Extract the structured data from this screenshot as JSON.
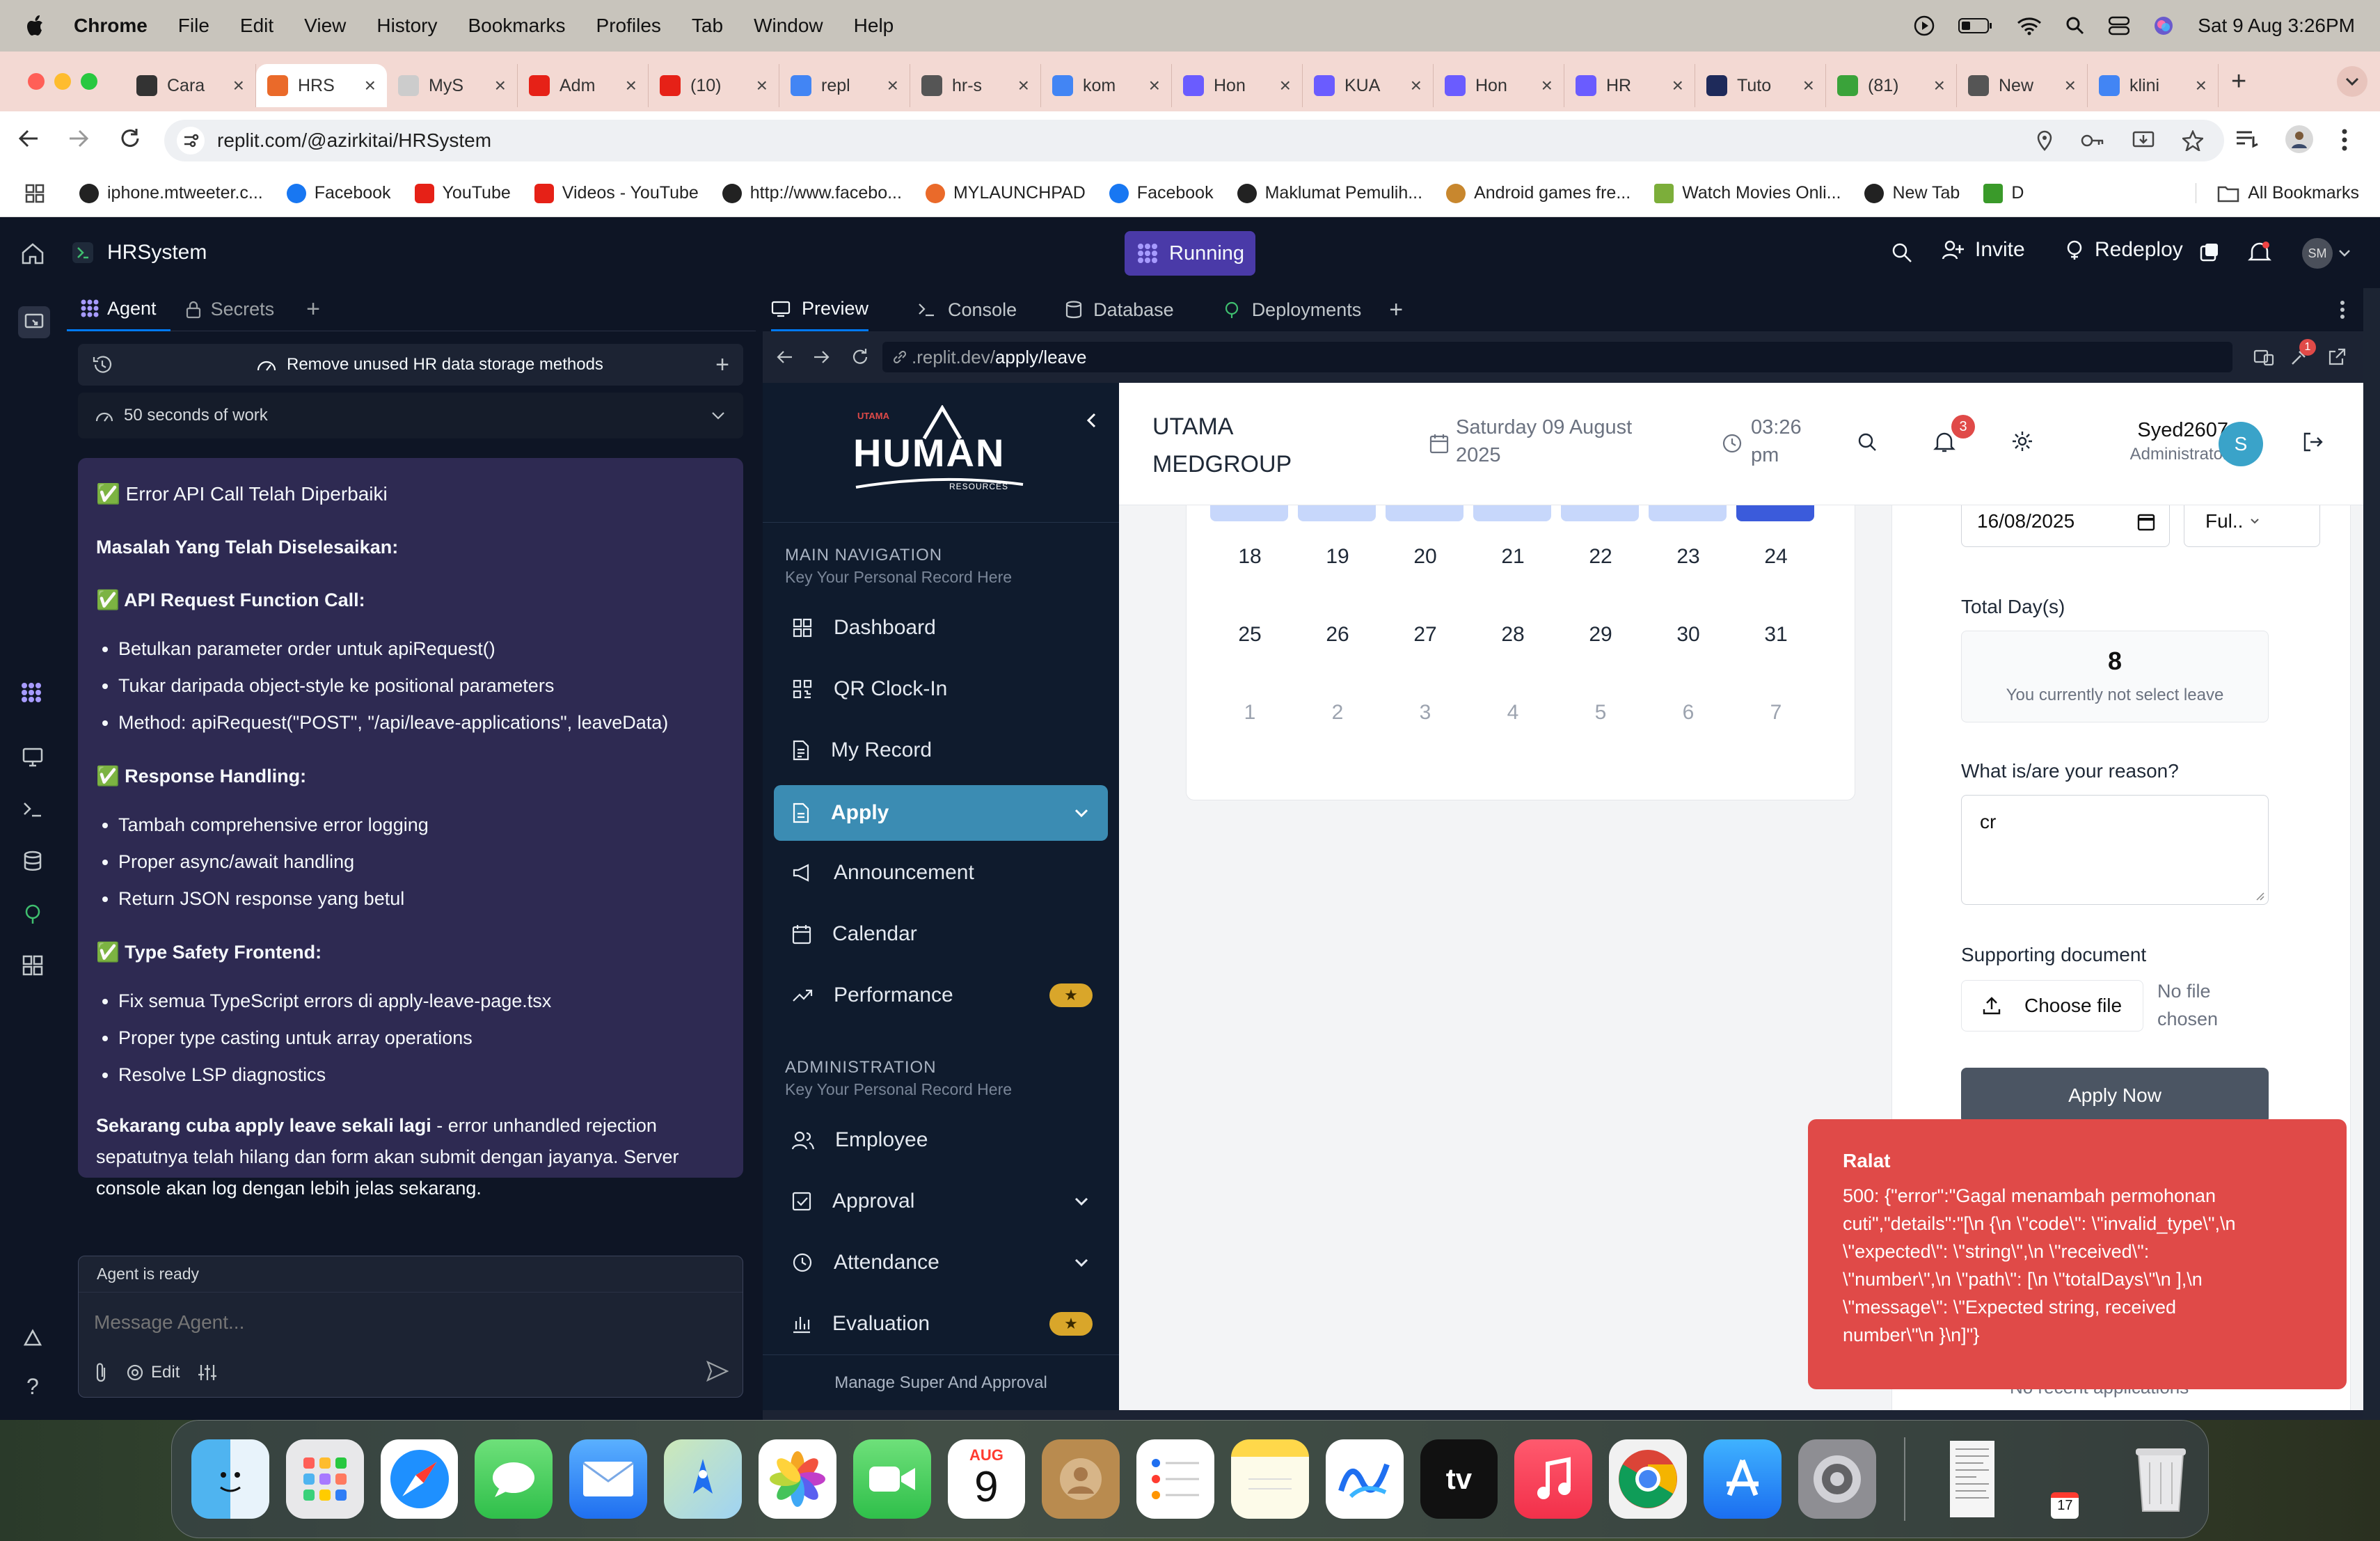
{
  "menubar": {
    "app": "Chrome",
    "items": [
      "File",
      "Edit",
      "View",
      "History",
      "Bookmarks",
      "Profiles",
      "Tab",
      "Window",
      "Help"
    ],
    "clock": "Sat 9 Aug  3:26PM"
  },
  "tabs": [
    {
      "label": "Cara",
      "active": false
    },
    {
      "label": "HRS",
      "active": true
    },
    {
      "label": "MyS",
      "active": false
    },
    {
      "label": "Adm",
      "active": false
    },
    {
      "label": "(10)",
      "active": false
    },
    {
      "label": "repl",
      "active": false
    },
    {
      "label": "hr-s",
      "active": false
    },
    {
      "label": "kom",
      "active": false
    },
    {
      "label": "Hon",
      "active": false
    },
    {
      "label": "KUA",
      "active": false
    },
    {
      "label": "Hon",
      "active": false
    },
    {
      "label": "HR",
      "active": false
    },
    {
      "label": "Tuto",
      "active": false
    },
    {
      "label": "(81)",
      "active": false
    },
    {
      "label": "New",
      "active": false
    },
    {
      "label": "klini",
      "active": false
    }
  ],
  "address": "replit.com/@azirkitai/HRSystem",
  "bookmarks": [
    "iphone.mtweeter.c...",
    "Facebook",
    "YouTube",
    "Videos - YouTube",
    "http://www.facebo...",
    "MYLAUNCHPAD",
    "Facebook",
    "Maklumat Pemulih...",
    "Android games fre...",
    "Watch Movies Onli...",
    "New Tab",
    "D"
  ],
  "bookmarks_all": "All Bookmarks",
  "replit": {
    "project": "HRSystem",
    "status": "Running",
    "invite": "Invite",
    "redeploy": "Redeploy",
    "avatar": "SM"
  },
  "agent_panel": {
    "tab_agent": "Agent",
    "tab_secrets": "Secrets",
    "thread_title": "Remove unused HR data storage methods",
    "work_time": "50 seconds of work",
    "msg_title": "✅ Error API Call Telah Diperbaiki",
    "msg_sub": "Masalah Yang Telah Diselesaikan:",
    "s1_title": "✅ API Request Function Call:",
    "s1_items": [
      "Betulkan parameter order untuk apiRequest()",
      "Tukar daripada object-style ke positional parameters",
      "Method: apiRequest(\"POST\", \"/api/leave-applications\", leaveData)"
    ],
    "s2_title": "✅ Response Handling:",
    "s2_items": [
      "Tambah comprehensive error logging",
      "Proper async/await handling",
      "Return JSON response yang betul"
    ],
    "s3_title": "✅ Type Safety Frontend:",
    "s3_items": [
      "Fix semua TypeScript errors di apply-leave-page.tsx",
      "Proper type casting untuk array operations",
      "Resolve LSP diagnostics"
    ],
    "closing_bold": "Sekarang cuba apply leave sekali lagi",
    "closing_rest": " - error unhandled rejection sepatutnya telah hilang dan form akan submit dengan jayanya. Server console akan log dengan lebih jelas sekarang.",
    "ready": "Agent is ready",
    "placeholder": "Message Agent...",
    "edit": "Edit"
  },
  "preview_tabs": [
    "Preview",
    "Console",
    "Database",
    "Deployments"
  ],
  "preview_url_prefix": ".replit.dev/",
  "preview_url_path": "apply/leave",
  "preview_badge": "1",
  "app": {
    "logo_small": "UTAMA",
    "logo_main": "HUMAN",
    "logo_sub": "RESOURCES",
    "nav_heading": "MAIN NAVIGATION",
    "nav_sub": "Key Your Personal Record Here",
    "nav": [
      "Dashboard",
      "QR Clock-In",
      "My Record",
      "Apply",
      "Announcement",
      "Calendar",
      "Performance"
    ],
    "admin_heading": "ADMINISTRATION",
    "admin_sub": "Key Your Personal Record Here",
    "admin": [
      "Employee",
      "Approval",
      "Attendance",
      "Evaluation"
    ],
    "footer": "Manage Super And Approval",
    "company_line1": "UTAMA",
    "company_line2": "MEDGROUP",
    "date_line1": "Saturday 09 August",
    "date_line2": "2025",
    "time_line1": "03:26",
    "time_line2": "pm",
    "notif_count": "3",
    "user_name": "Syed2607",
    "user_role": "Administrator",
    "user_initial": "S"
  },
  "calendar": {
    "rows": [
      [
        "18",
        "19",
        "20",
        "21",
        "22",
        "23",
        "24"
      ],
      [
        "25",
        "26",
        "27",
        "28",
        "29",
        "30",
        "31"
      ],
      [
        "1",
        "2",
        "3",
        "4",
        "5",
        "6",
        "7"
      ]
    ]
  },
  "form": {
    "end_date": "16/08/2025",
    "day_type": "Ful..",
    "total_label": "Total Day(s)",
    "total_value": "8",
    "total_note": "You currently not select leave",
    "reason_label": "What is/are your reason?",
    "reason_value": "cr",
    "doc_label": "Supporting document",
    "choose_file": "Choose file",
    "no_file_1": "No file",
    "no_file_2": "chosen",
    "apply_btn": "Apply Now",
    "recent": "No recent applications"
  },
  "toast": {
    "title": "Ralat",
    "lines": [
      "500: {\"error\":\"Gagal menambah permohonan",
      "cuti\",\"details\":\"[\\n {\\n \\\"code\\\": \\\"invalid_type\\\",\\n",
      "\\\"expected\\\": \\\"string\\\",\\n \\\"received\\\":",
      "\\\"number\\\",\\n \\\"path\\\": [\\n \\\"totalDays\\\"\\n ],\\n",
      "\\\"message\\\": \\\"Expected string, received",
      "number\\\"\\n }\\n]\"}"
    ]
  },
  "dock": {
    "calendar_month": "AUG",
    "calendar_day": "9",
    "tv_label": "tv",
    "mini_cal_day": "17"
  }
}
